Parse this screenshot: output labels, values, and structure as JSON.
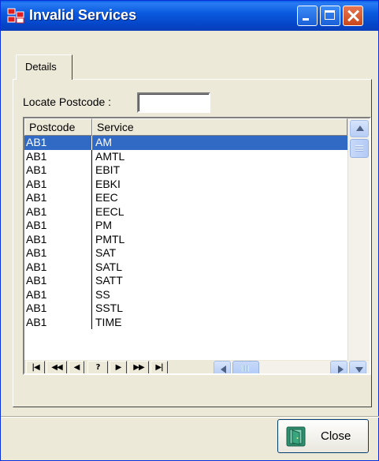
{
  "window": {
    "title": "Invalid Services"
  },
  "tabs": [
    {
      "label": "Details"
    }
  ],
  "locate": {
    "label": "Locate Postcode :",
    "value": ""
  },
  "grid": {
    "columns": [
      "Postcode",
      "Service"
    ],
    "selected_index": 0,
    "rows": [
      [
        "AB1",
        "AM"
      ],
      [
        "AB1",
        "AMTL"
      ],
      [
        "AB1",
        "EBIT"
      ],
      [
        "AB1",
        "EBKI"
      ],
      [
        "AB1",
        "EEC"
      ],
      [
        "AB1",
        "EECL"
      ],
      [
        "AB1",
        "PM"
      ],
      [
        "AB1",
        "PMTL"
      ],
      [
        "AB1",
        "SAT"
      ],
      [
        "AB1",
        "SATL"
      ],
      [
        "AB1",
        "SATT"
      ],
      [
        "AB1",
        "SS"
      ],
      [
        "AB1",
        "SSTL"
      ],
      [
        "AB1",
        "TIME"
      ]
    ]
  },
  "navigator": {
    "buttons": [
      {
        "name": "nav-first-button",
        "glyph": "|◀"
      },
      {
        "name": "nav-prior-page-button",
        "glyph": "◀◀"
      },
      {
        "name": "nav-prior-button",
        "glyph": "◀"
      },
      {
        "name": "nav-locate-button",
        "glyph": "?"
      },
      {
        "name": "nav-next-button",
        "glyph": "▶"
      },
      {
        "name": "nav-next-page-button",
        "glyph": "▶▶"
      },
      {
        "name": "nav-last-button",
        "glyph": "▶|"
      }
    ]
  },
  "footer": {
    "close_label": "Close"
  },
  "colors": {
    "title_bar": "#0a5fe8",
    "selection": "#316ac5",
    "face": "#ece9d8"
  }
}
